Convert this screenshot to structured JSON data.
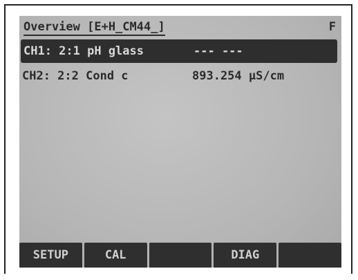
{
  "header": {
    "title": "Overview [E+H_CM44_]",
    "indicator": "F"
  },
  "channels": [
    {
      "label": "CH1: 2:1 pH glass",
      "value": "--- ---",
      "selected": true
    },
    {
      "label": "CH2: 2:2 Cond c",
      "value": "893.254 µS/cm",
      "selected": false
    }
  ],
  "softkeys": [
    {
      "label": "SETUP"
    },
    {
      "label": "CAL"
    },
    {
      "label": ""
    },
    {
      "label": "DIAG"
    },
    {
      "label": ""
    }
  ],
  "colors": {
    "lcd_background": "#b9b9b9",
    "selection_bar": "#2e2e2e",
    "softkey_background": "#2f2f2f",
    "text_dark": "#2b2b2b"
  }
}
